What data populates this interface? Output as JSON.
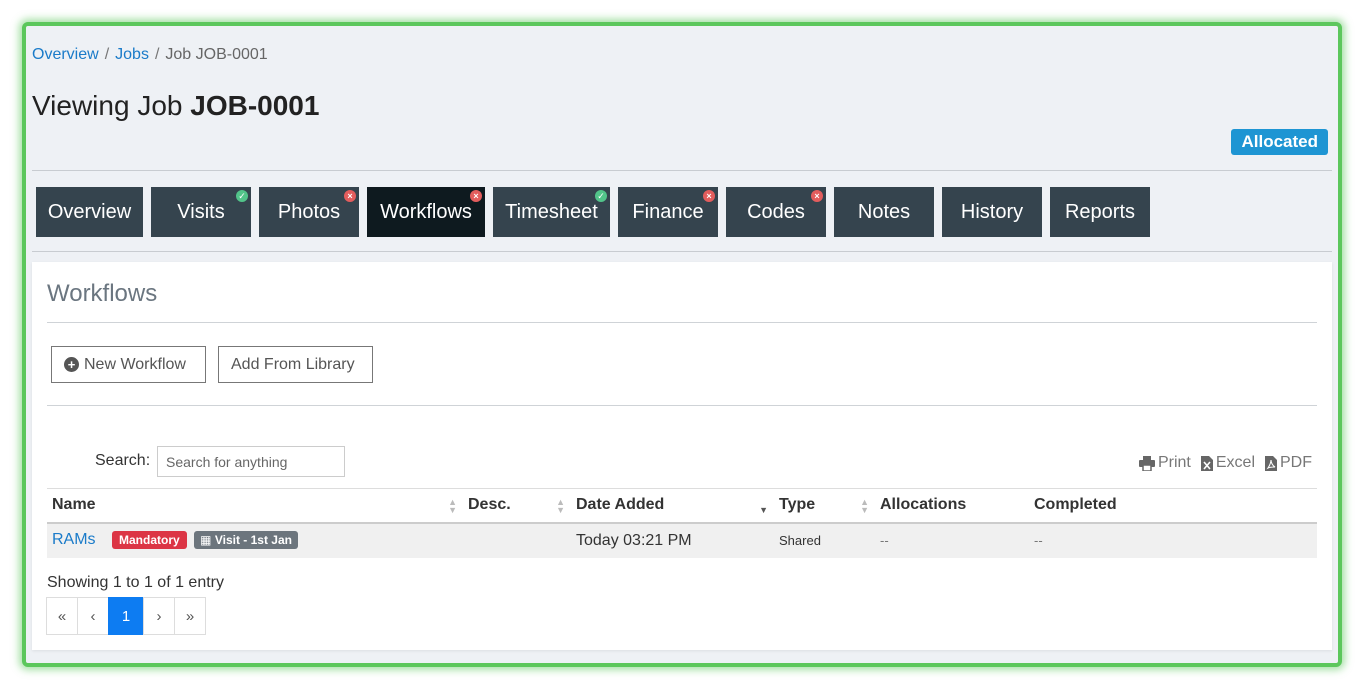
{
  "breadcrumb": {
    "items": [
      "Overview",
      "Jobs"
    ],
    "current": "Job JOB-0001",
    "separator": "/"
  },
  "page": {
    "title_prefix": "Viewing Job",
    "title_job": "JOB-0001",
    "status": "Allocated"
  },
  "tabs": [
    {
      "label": "Overview",
      "indicator": ""
    },
    {
      "label": "Visits",
      "indicator": "check"
    },
    {
      "label": "Photos",
      "indicator": "error"
    },
    {
      "label": "Workflows",
      "indicator": "error",
      "active": true
    },
    {
      "label": "Timesheet",
      "indicator": "check"
    },
    {
      "label": "Finance",
      "indicator": "error"
    },
    {
      "label": "Codes",
      "indicator": "error"
    },
    {
      "label": "Notes",
      "indicator": ""
    },
    {
      "label": "History",
      "indicator": ""
    },
    {
      "label": "Reports",
      "indicator": ""
    }
  ],
  "panel": {
    "title": "Workflows",
    "new_button": "New Workflow",
    "library_button": "Add From Library",
    "search_label": "Search:",
    "search_placeholder": "Search for anything",
    "exports": {
      "print": "Print",
      "excel": "Excel",
      "pdf": "PDF"
    }
  },
  "table": {
    "columns": [
      "Name",
      "Desc.",
      "Date Added",
      "Type",
      "Allocations",
      "Completed"
    ],
    "rows": [
      {
        "name": "RAMs",
        "badge_mandatory": "Mandatory",
        "badge_visit": "Visit - 1st Jan",
        "desc": "",
        "date_added": "Today 03:21 PM",
        "type": "Shared",
        "allocations": "--",
        "completed": "--"
      }
    ]
  },
  "footer": {
    "showing": "Showing 1 to 1 of 1 entry"
  },
  "pagination": {
    "first": "«",
    "prev": "‹",
    "current": "1",
    "next": "›",
    "last": "»"
  },
  "colors": {
    "frame": "#5cc75c",
    "tab": "#35444e",
    "tab_active": "#0e1a1f",
    "status": "#1e95d3",
    "link": "#1a7bc9",
    "mandatory": "#dc3545",
    "page_active": "#0d7cf2"
  }
}
